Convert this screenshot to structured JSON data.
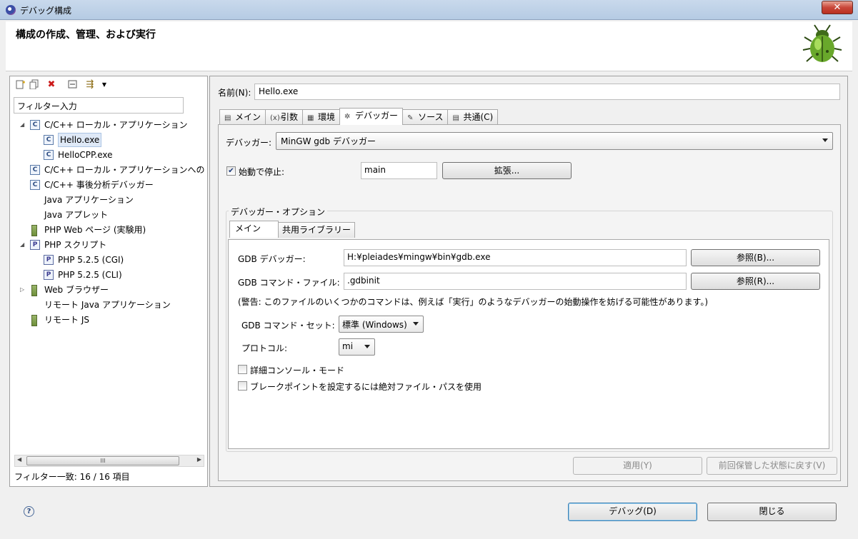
{
  "window": {
    "title": "デバッグ構成",
    "close_label": "✕"
  },
  "banner": {
    "heading": "構成の作成、管理、および実行",
    "bug_icon": "bug-icon"
  },
  "left": {
    "toolbar_icons": [
      "new-config-icon",
      "duplicate-icon",
      "delete-icon",
      "collapse-icon",
      "filter-icon",
      "dropdown-icon"
    ],
    "filter_placeholder": "フィルター入力",
    "tree": [
      {
        "label": "C/C++ ローカル・アプリケーション",
        "icon": "C",
        "level": 0,
        "expanded": true
      },
      {
        "label": "Hello.exe",
        "icon": "C",
        "level": 1,
        "selected": true
      },
      {
        "label": "HelloCPP.exe",
        "icon": "C",
        "level": 1
      },
      {
        "label": "C/C++ ローカル・アプリケーションへの",
        "icon": "C",
        "level": 0
      },
      {
        "label": "C/C++ 事後分析デバッガー",
        "icon": "C",
        "level": 0
      },
      {
        "label": "Java アプリケーション",
        "icon": "",
        "level": 0
      },
      {
        "label": "Java アプレット",
        "icon": "",
        "level": 0
      },
      {
        "label": "PHP Web ページ (実験用)",
        "icon": "bat",
        "level": 0
      },
      {
        "label": "PHP スクリプト",
        "icon": "P",
        "level": 0,
        "expanded": true
      },
      {
        "label": "PHP 5.2.5 (CGI)",
        "icon": "P",
        "level": 1
      },
      {
        "label": "PHP 5.2.5 (CLI)",
        "icon": "P",
        "level": 1
      },
      {
        "label": "Web ブラウザー",
        "icon": "bat",
        "level": 0,
        "collapsed": true
      },
      {
        "label": "リモート Java アプリケーション",
        "icon": "",
        "level": 0
      },
      {
        "label": "リモート JS",
        "icon": "bat",
        "level": 0
      }
    ],
    "scroll_thumb": "III",
    "filter_count": "フィルター一致: 16 / 16 項目"
  },
  "right": {
    "name_label": "名前(N):",
    "name_value": "Hello.exe",
    "tabs": [
      {
        "label": "メイン",
        "icon": "▤"
      },
      {
        "label": "引数",
        "icon": "(x)="
      },
      {
        "label": "環境",
        "icon": "▦"
      },
      {
        "label": "デバッガー",
        "icon": "✲",
        "active": true
      },
      {
        "label": "ソース",
        "icon": "✎"
      },
      {
        "label": "共通(C)",
        "icon": "▤"
      }
    ],
    "debugger_label": "デバッガー:",
    "debugger_value": "MinGW gdb デバッガー",
    "stop_label": "始動で停止:",
    "stop_checked": true,
    "stop_value": "main",
    "advanced_button": "拡張...",
    "options_legend": "デバッガー・オプション",
    "inner_tabs": [
      "メイン",
      "共用ライブラリー"
    ],
    "gdb_debugger_label": "GDB デバッガー:",
    "gdb_debugger_value": "H:¥pleiades¥mingw¥bin¥gdb.exe",
    "browse_b": "参照(B)...",
    "gdb_command_label": "GDB コマンド・ファイル:",
    "gdb_command_value": ".gdbinit",
    "browse_r": "参照(R)...",
    "warning": "(警告: このファイルのいくつかのコマンドは、例えば「実行」のようなデバッガーの始動操作を妨げる可能性があります。)",
    "command_set_label": "GDB コマンド・セット:",
    "command_set_value": "標準 (Windows)",
    "protocol_label": "プロトコル:",
    "protocol_value": "mi",
    "verbose_label": "詳細コンソール・モード",
    "verbose_checked": false,
    "abspath_label": "ブレークポイントを設定するには絶対ファイル・パスを使用",
    "abspath_checked": false,
    "apply_button": "適用(Y)",
    "revert_button": "前回保管した状態に戻す(V)"
  },
  "bottom": {
    "debug_button": "デバッグ(D)",
    "close_button": "閉じる",
    "help_icon": "?"
  }
}
